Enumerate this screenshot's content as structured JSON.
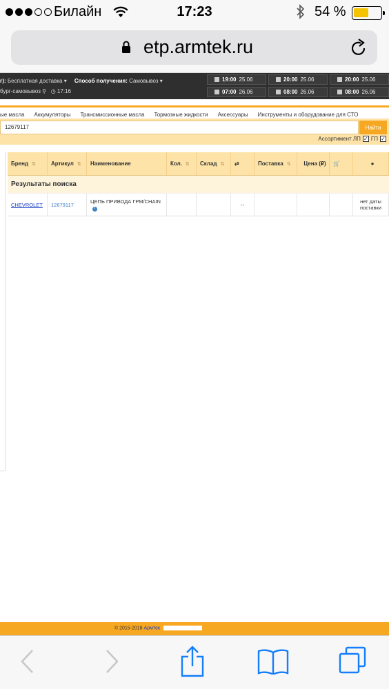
{
  "status_bar": {
    "carrier": "Билайн",
    "time": "17:23",
    "battery": "54 %",
    "battery_level": 0.54,
    "signal_strength": 3
  },
  "browser": {
    "url": "etp.armtek.ru"
  },
  "header_info": {
    "delivery_prefix": "г):",
    "delivery_value": "Бесплатная доставка",
    "receive_label": "Способ получения:",
    "receive_value": "Самовывоз",
    "location": "бург-самовывоз",
    "location_time": "17:16"
  },
  "delivery_tiles": [
    {
      "time": "19:00",
      "date": "25.06"
    },
    {
      "time": "20:00",
      "date": "25.06"
    },
    {
      "time": "20:00",
      "date": "25.06"
    },
    {
      "time": "07:00",
      "date": "26.06"
    },
    {
      "time": "08:00",
      "date": "26.06"
    },
    {
      "time": "08:00",
      "date": "26.06"
    }
  ],
  "nav_menu": [
    "ые масла",
    "Аккумуляторы",
    "Трансмиссионные масла",
    "Тормозные жидкости",
    "Аксессуары",
    "Инструменты и оборудование для СТО"
  ],
  "search": {
    "value": "12679117",
    "button": "Найти",
    "assortment_label": "Ассортимент ЛП",
    "gp_label": "ГП"
  },
  "table": {
    "headers": {
      "brand": "Бренд",
      "article": "Артикул",
      "name": "Наименование",
      "qty": "Кол.",
      "warehouse": "Склад",
      "delivery": "Поставка",
      "price": "Цена (₽)"
    },
    "group_title": "Результаты поиска",
    "rows": [
      {
        "brand": "CHEVROLET",
        "article": "12679117",
        "name": "ЦЕПЬ ПРИВОДА ГРМ/CHAIN",
        "dash": "--",
        "note": "нет даты поставки"
      }
    ]
  },
  "footer": {
    "copyright": "© 2015-2018",
    "link": "Армтек"
  }
}
